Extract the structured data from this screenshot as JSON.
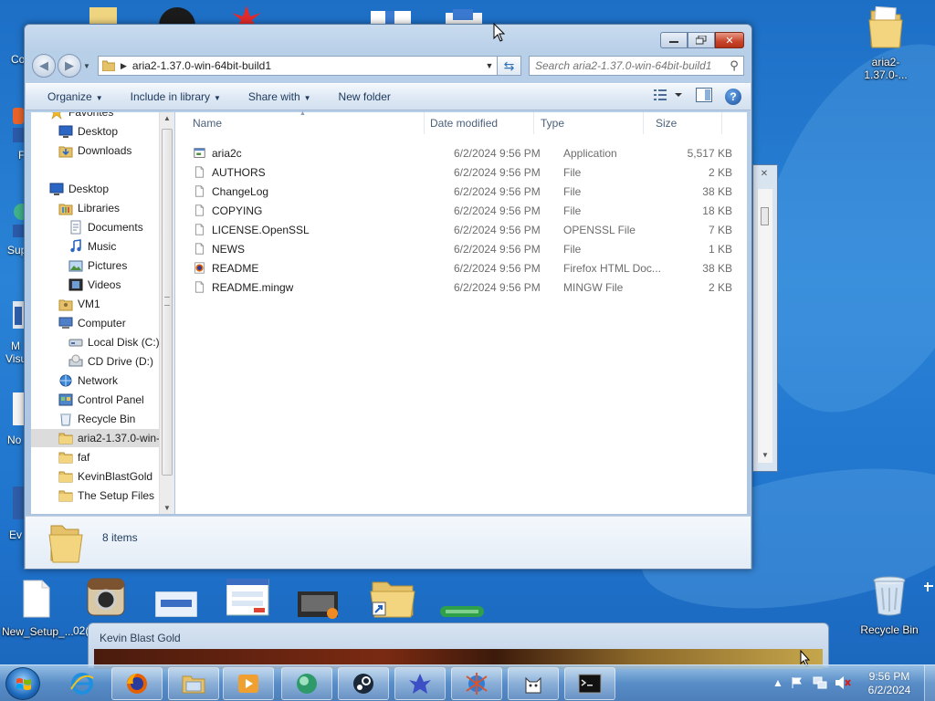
{
  "window": {
    "address_path": "aria2-1.37.0-win-64bit-build1",
    "search_placeholder": "Search aria2-1.37.0-win-64bit-build1",
    "toolbar": {
      "organize": "Organize",
      "include_in_library": "Include in library",
      "share_with": "Share with",
      "new_folder": "New folder"
    },
    "columns": {
      "name": "Name",
      "date": "Date modified",
      "type": "Type",
      "size": "Size"
    },
    "files": [
      {
        "name": "aria2c",
        "date": "6/2/2024 9:56 PM",
        "type": "Application",
        "size": "5,517 KB",
        "icon": "application-icon"
      },
      {
        "name": "AUTHORS",
        "date": "6/2/2024 9:56 PM",
        "type": "File",
        "size": "2 KB",
        "icon": "file-icon"
      },
      {
        "name": "ChangeLog",
        "date": "6/2/2024 9:56 PM",
        "type": "File",
        "size": "38 KB",
        "icon": "file-icon"
      },
      {
        "name": "COPYING",
        "date": "6/2/2024 9:56 PM",
        "type": "File",
        "size": "18 KB",
        "icon": "file-icon"
      },
      {
        "name": "LICENSE.OpenSSL",
        "date": "6/2/2024 9:56 PM",
        "type": "OPENSSL File",
        "size": "7 KB",
        "icon": "file-icon"
      },
      {
        "name": "NEWS",
        "date": "6/2/2024 9:56 PM",
        "type": "File",
        "size": "1 KB",
        "icon": "file-icon"
      },
      {
        "name": "README",
        "date": "6/2/2024 9:56 PM",
        "type": "Firefox HTML Doc...",
        "size": "38 KB",
        "icon": "firefox-html-icon"
      },
      {
        "name": "README.mingw",
        "date": "6/2/2024 9:56 PM",
        "type": "MINGW File",
        "size": "2 KB",
        "icon": "file-icon"
      }
    ],
    "nav": [
      {
        "label": "Favorites",
        "icon": "star-icon",
        "indent": 0
      },
      {
        "label": "Desktop",
        "icon": "desktop-icon",
        "indent": 1
      },
      {
        "label": "Downloads",
        "icon": "downloads-icon",
        "indent": 1
      },
      {
        "label": "Desktop",
        "icon": "desktop-icon",
        "indent": 0
      },
      {
        "label": "Libraries",
        "icon": "libraries-icon",
        "indent": 1
      },
      {
        "label": "Documents",
        "icon": "documents-icon",
        "indent": 2
      },
      {
        "label": "Music",
        "icon": "music-icon",
        "indent": 2
      },
      {
        "label": "Pictures",
        "icon": "pictures-icon",
        "indent": 2
      },
      {
        "label": "Videos",
        "icon": "videos-icon",
        "indent": 2
      },
      {
        "label": "VM1",
        "icon": "user-folder-icon",
        "indent": 1
      },
      {
        "label": "Computer",
        "icon": "computer-icon",
        "indent": 1
      },
      {
        "label": "Local Disk (C:)",
        "icon": "disk-icon",
        "indent": 2
      },
      {
        "label": "CD Drive (D:)",
        "icon": "cd-drive-icon",
        "indent": 2
      },
      {
        "label": "Network",
        "icon": "network-icon",
        "indent": 1
      },
      {
        "label": "Control Panel",
        "icon": "control-panel-icon",
        "indent": 1
      },
      {
        "label": "Recycle Bin",
        "icon": "recycle-bin-icon",
        "indent": 1
      },
      {
        "label": "aria2-1.37.0-win-",
        "icon": "folder-icon",
        "indent": 1,
        "selected": true
      },
      {
        "label": "faf",
        "icon": "folder-icon",
        "indent": 1
      },
      {
        "label": "KevinBlastGold",
        "icon": "folder-icon",
        "indent": 1
      },
      {
        "label": "The Setup Files",
        "icon": "folder-icon",
        "indent": 1
      }
    ],
    "item_count": "8 items"
  },
  "desktop": {
    "top_right_icon": "aria2-1.37.0-...",
    "recycle_bin": "Recycle Bin",
    "new_setup": "New_Setup_...",
    "partial_02": "02(",
    "left_partial_labels": [
      "Co",
      "F",
      "Sup",
      "M",
      "Visu",
      "No",
      "Ev"
    ]
  },
  "game_window": {
    "title": "Kevin Blast Gold"
  },
  "taskbar": {
    "time": "9:56 PM",
    "date": "6/2/2024",
    "apps": [
      "internet-explorer-icon",
      "firefox-icon",
      "file-explorer-icon",
      "media-player-icon",
      "green-orb-icon",
      "steam-icon",
      "blue-creature-icon",
      "globe-bug-icon",
      "cat-icon",
      "command-prompt-icon"
    ]
  },
  "colors": {
    "desktop_blue": "#1f73cc",
    "window_frame": "#b8cfe8",
    "close_red": "#c7432a",
    "selection": "#dcdcdc"
  }
}
